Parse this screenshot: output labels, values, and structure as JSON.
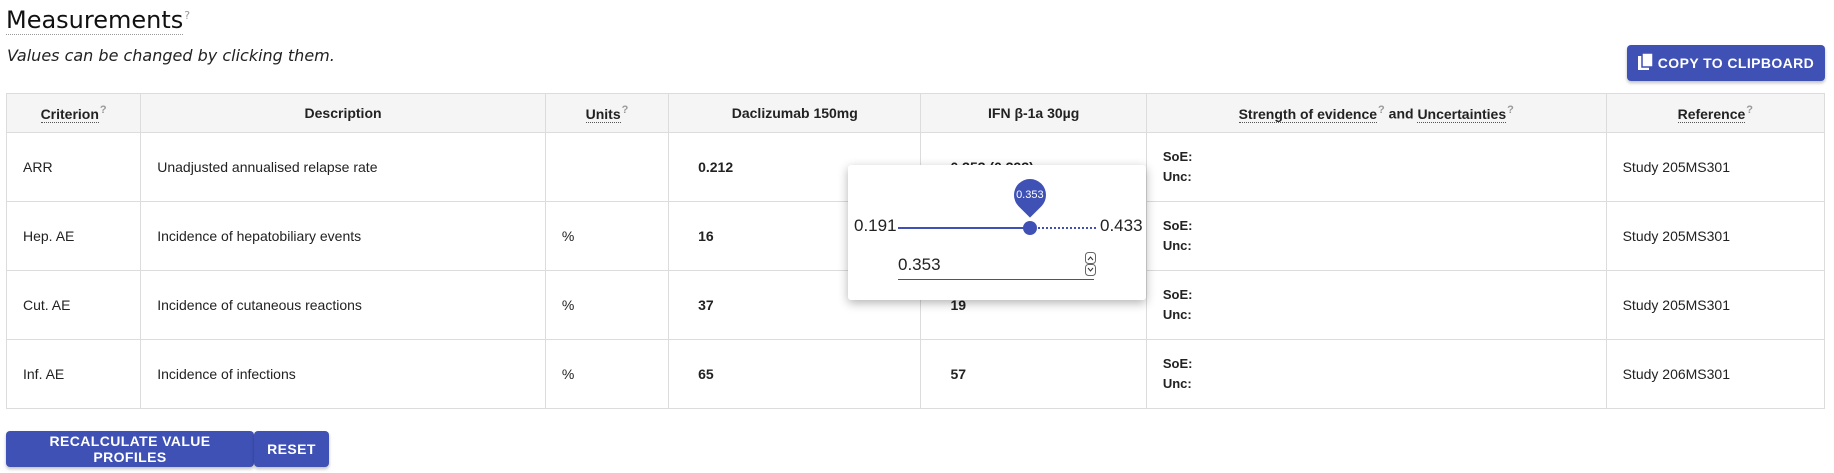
{
  "page": {
    "title": "Measurements",
    "help_mark": "?",
    "subtitle": "Values can be changed by clicking them.",
    "copy_button": "COPY TO CLIPBOARD",
    "recalc_button": "RECALCULATE VALUE PROFILES",
    "reset_button": "RESET"
  },
  "table": {
    "headers": {
      "criterion": "Criterion",
      "description": "Description",
      "units": "Units",
      "alt1": "Daclizumab 150mg",
      "alt2": "IFN β-1a 30µg",
      "soe_part1": "Strength of evidence",
      "soe_and": " and ",
      "soe_part2": "Uncertainties",
      "reference": "Reference"
    },
    "soe_label": "SoE:",
    "unc_label": "Unc:",
    "rows": [
      {
        "criterion": "ARR",
        "description": "Unadjusted annualised relapse rate",
        "units": "",
        "alt1": "0.212",
        "alt2": "0.353 (0.393)",
        "reference": "Study 205MS301"
      },
      {
        "criterion": "Hep. AE",
        "description": "Incidence of hepatobiliary events",
        "units": "%",
        "alt1": "16",
        "alt2": "",
        "reference": "Study 205MS301"
      },
      {
        "criterion": "Cut. AE",
        "description": "Incidence of cutaneous reactions",
        "units": "%",
        "alt1": "37",
        "alt2": "19",
        "reference": "Study 205MS301"
      },
      {
        "criterion": "Inf. AE",
        "description": "Incidence of infections",
        "units": "%",
        "alt1": "65",
        "alt2": "57",
        "reference": "Study 206MS301"
      }
    ]
  },
  "popup": {
    "min": "0.191",
    "max": "0.433",
    "value": "0.353",
    "input_value": "0.353",
    "slider_fraction": 0.669
  },
  "colors": {
    "accent": "#3f51b5",
    "link": "#1976d2"
  }
}
